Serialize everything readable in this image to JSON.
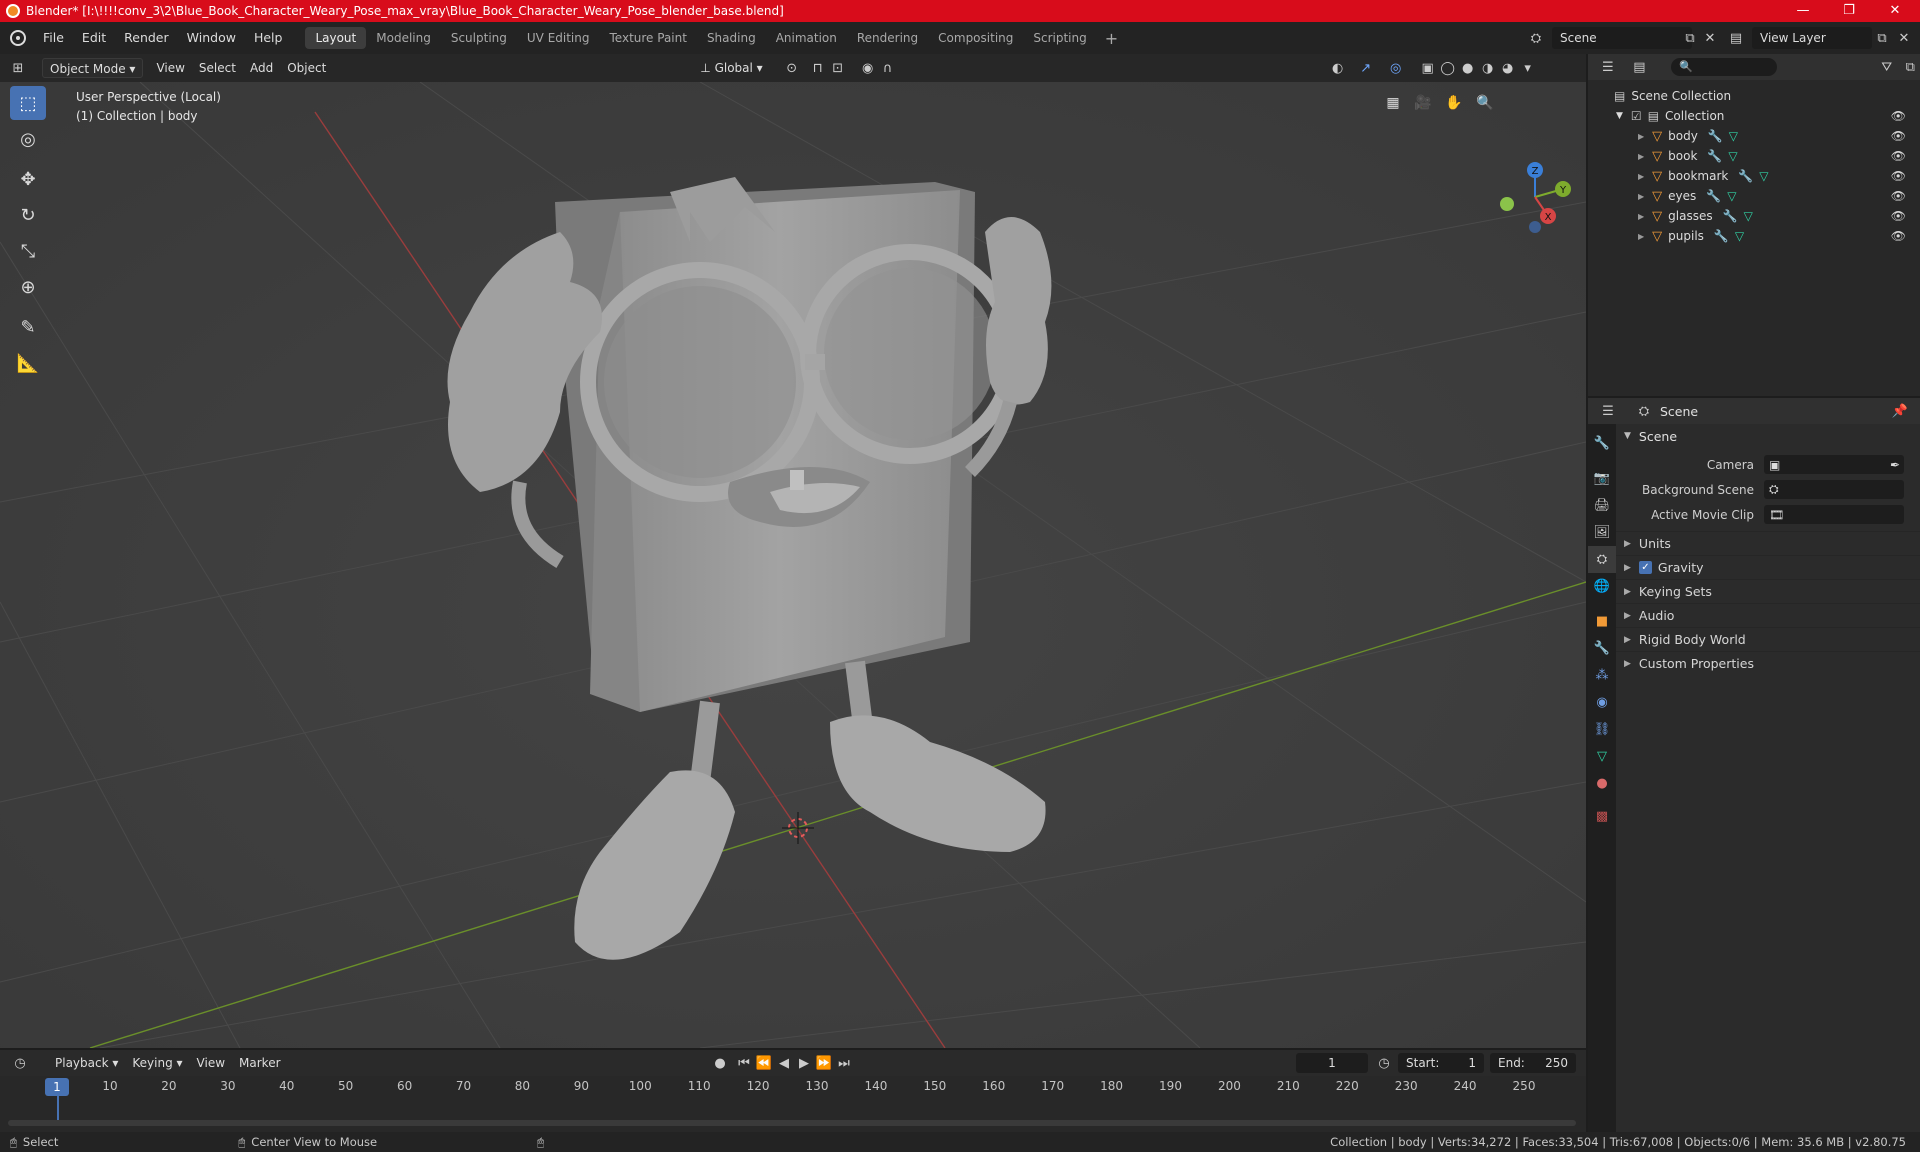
{
  "window": {
    "title": "Blender* [I:\\!!!!conv_3\\2\\Blue_Book_Character_Weary_Pose_max_vray\\Blue_Book_Character_Weary_Pose_blender_base.blend]",
    "minimize": "—",
    "maximize": "❐",
    "close": "✕"
  },
  "menu": {
    "items": [
      "File",
      "Edit",
      "Render",
      "Window",
      "Help"
    ]
  },
  "workspaces": {
    "tabs": [
      "Layout",
      "Modeling",
      "Sculpting",
      "UV Editing",
      "Texture Paint",
      "Shading",
      "Animation",
      "Rendering",
      "Compositing",
      "Scripting"
    ],
    "active": "Layout",
    "add": "+"
  },
  "scene_selector": {
    "value": "Scene"
  },
  "view_layer_selector": {
    "value": "View Layer"
  },
  "viewport_header": {
    "mode": "Object Mode",
    "menus": [
      "View",
      "Select",
      "Add",
      "Object"
    ],
    "transform_orientation": "Global"
  },
  "viewport": {
    "perspective_label": "User Perspective (Local)",
    "collection_label": "(1) Collection | body",
    "gizmo": {
      "z": "Z",
      "y": "Y",
      "x": "X"
    }
  },
  "outliner": {
    "search_placeholder": "",
    "root": "Scene Collection",
    "collection": "Collection",
    "objects": [
      {
        "name": "body"
      },
      {
        "name": "book"
      },
      {
        "name": "bookmark"
      },
      {
        "name": "eyes"
      },
      {
        "name": "glasses"
      },
      {
        "name": "pupils"
      }
    ]
  },
  "properties": {
    "header": "Scene",
    "panel_title": "Scene",
    "fields": [
      {
        "label": "Camera",
        "value": ""
      },
      {
        "label": "Background Scene",
        "value": ""
      },
      {
        "label": "Active Movie Clip",
        "value": ""
      }
    ],
    "sections": [
      "Units",
      "Gravity",
      "Keying Sets",
      "Audio",
      "Rigid Body World",
      "Custom Properties"
    ],
    "gravity_checked": true
  },
  "timeline": {
    "menus": [
      "Playback",
      "Keying",
      "View",
      "Marker"
    ],
    "current_frame": "1",
    "start_label": "Start:",
    "start": "1",
    "end_label": "End:",
    "end": "250",
    "ticks": [
      "10",
      "20",
      "30",
      "40",
      "50",
      "60",
      "70",
      "80",
      "90",
      "100",
      "110",
      "120",
      "130",
      "140",
      "150",
      "160",
      "170",
      "180",
      "190",
      "200",
      "210",
      "220",
      "230",
      "240",
      "250"
    ],
    "playhead_label": "1"
  },
  "statusbar": {
    "select": "Select",
    "center_view": "Center View to Mouse",
    "stats": "Collection | body | Verts:34,272 | Faces:33,504 | Tris:67,008 | Objects:0/6 | Mem: 35.6 MB | v2.80.75"
  },
  "colors": {
    "titlebar": "#d80c1b",
    "accent": "#4772b3",
    "mesh_orange": "#f19a37",
    "modifier_blue": "#6f9ee3",
    "data_green": "#31d1a4"
  }
}
